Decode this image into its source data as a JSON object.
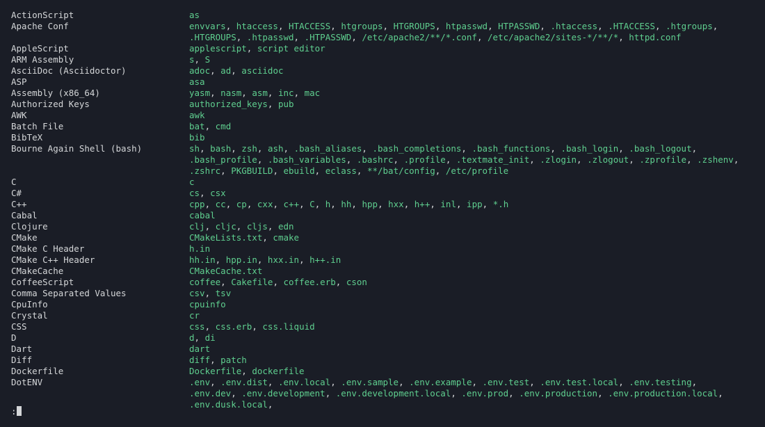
{
  "prompt": ":",
  "colors": {
    "background": "#1a1d26",
    "foreground": "#d4d6d8",
    "accent": "#5fcf8f"
  },
  "languages": [
    {
      "name": "ActionScript",
      "extensions": [
        "as"
      ]
    },
    {
      "name": "Apache Conf",
      "extensions": [
        "envvars",
        "htaccess",
        "HTACCESS",
        "htgroups",
        "HTGROUPS",
        "htpasswd",
        "HTPASSWD",
        ".htaccess",
        ".HTACCESS",
        ".htgroups",
        ".HTGROUPS",
        ".htpasswd",
        ".HTPASSWD",
        "/etc/apache2/**/*.conf",
        "/etc/apache2/sites-*/**/*",
        "httpd.conf"
      ]
    },
    {
      "name": "AppleScript",
      "extensions": [
        "applescript",
        "script editor"
      ]
    },
    {
      "name": "ARM Assembly",
      "extensions": [
        "s",
        "S"
      ]
    },
    {
      "name": "AsciiDoc (Asciidoctor)",
      "extensions": [
        "adoc",
        "ad",
        "asciidoc"
      ]
    },
    {
      "name": "ASP",
      "extensions": [
        "asa"
      ]
    },
    {
      "name": "Assembly (x86_64)",
      "extensions": [
        "yasm",
        "nasm",
        "asm",
        "inc",
        "mac"
      ]
    },
    {
      "name": "Authorized Keys",
      "extensions": [
        "authorized_keys",
        "pub"
      ]
    },
    {
      "name": "AWK",
      "extensions": [
        "awk"
      ]
    },
    {
      "name": "Batch File",
      "extensions": [
        "bat",
        "cmd"
      ]
    },
    {
      "name": "BibTeX",
      "extensions": [
        "bib"
      ]
    },
    {
      "name": "Bourne Again Shell (bash)",
      "extensions": [
        "sh",
        "bash",
        "zsh",
        "ash",
        ".bash_aliases",
        ".bash_completions",
        ".bash_functions",
        ".bash_login",
        ".bash_logout",
        ".bash_profile",
        ".bash_variables",
        ".bashrc",
        ".profile",
        ".textmate_init",
        ".zlogin",
        ".zlogout",
        ".zprofile",
        ".zshenv",
        ".zshrc",
        "PKGBUILD",
        "ebuild",
        "eclass",
        "**/bat/config",
        "/etc/profile"
      ]
    },
    {
      "name": "C",
      "extensions": [
        "c"
      ]
    },
    {
      "name": "C#",
      "extensions": [
        "cs",
        "csx"
      ]
    },
    {
      "name": "C++",
      "extensions": [
        "cpp",
        "cc",
        "cp",
        "cxx",
        "c++",
        "C",
        "h",
        "hh",
        "hpp",
        "hxx",
        "h++",
        "inl",
        "ipp",
        "*.h"
      ]
    },
    {
      "name": "Cabal",
      "extensions": [
        "cabal"
      ]
    },
    {
      "name": "Clojure",
      "extensions": [
        "clj",
        "cljc",
        "cljs",
        "edn"
      ]
    },
    {
      "name": "CMake",
      "extensions": [
        "CMakeLists.txt",
        "cmake"
      ]
    },
    {
      "name": "CMake C Header",
      "extensions": [
        "h.in"
      ]
    },
    {
      "name": "CMake C++ Header",
      "extensions": [
        "hh.in",
        "hpp.in",
        "hxx.in",
        "h++.in"
      ]
    },
    {
      "name": "CMakeCache",
      "extensions": [
        "CMakeCache.txt"
      ]
    },
    {
      "name": "CoffeeScript",
      "extensions": [
        "coffee",
        "Cakefile",
        "coffee.erb",
        "cson"
      ]
    },
    {
      "name": "Comma Separated Values",
      "extensions": [
        "csv",
        "tsv"
      ]
    },
    {
      "name": "CpuInfo",
      "extensions": [
        "cpuinfo"
      ]
    },
    {
      "name": "Crystal",
      "extensions": [
        "cr"
      ]
    },
    {
      "name": "CSS",
      "extensions": [
        "css",
        "css.erb",
        "css.liquid"
      ]
    },
    {
      "name": "D",
      "extensions": [
        "d",
        "di"
      ]
    },
    {
      "name": "Dart",
      "extensions": [
        "dart"
      ]
    },
    {
      "name": "Diff",
      "extensions": [
        "diff",
        "patch"
      ]
    },
    {
      "name": "Dockerfile",
      "extensions": [
        "Dockerfile",
        "dockerfile"
      ]
    },
    {
      "name": "DotENV",
      "extensions": [
        ".env",
        ".env.dist",
        ".env.local",
        ".env.sample",
        ".env.example",
        ".env.test",
        ".env.test.local",
        ".env.testing",
        ".env.dev",
        ".env.development",
        ".env.development.local",
        ".env.prod",
        ".env.production",
        ".env.production.local",
        ".env.dusk.local"
      ],
      "trailing": true
    }
  ]
}
